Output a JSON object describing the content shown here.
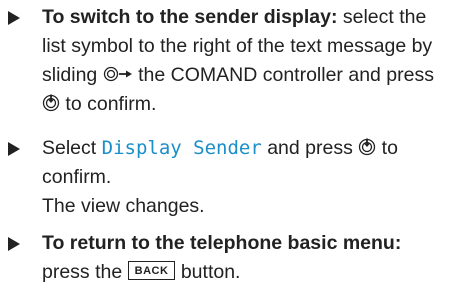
{
  "steps": [
    {
      "bold": "To switch to the sender display:",
      "text_a": " select the list symbol to the right of the text message by sliding ",
      "icon_slide": "controller-slide-right-icon",
      "text_b": " the COMAND controller and press ",
      "icon_press": "controller-press-icon",
      "text_c": " to confirm."
    },
    {
      "text_a": "Select ",
      "highlight": "Display Sender",
      "text_b": " and press ",
      "icon_press": "controller-press-icon",
      "text_c": " to confirm.",
      "result": "The view changes."
    },
    {
      "bold": "To return to the telephone basic menu:",
      "text_a": " press the ",
      "key": "BACK",
      "text_b": " button."
    }
  ],
  "colors": {
    "text": "#222222",
    "highlight": "#1a8fc8"
  }
}
